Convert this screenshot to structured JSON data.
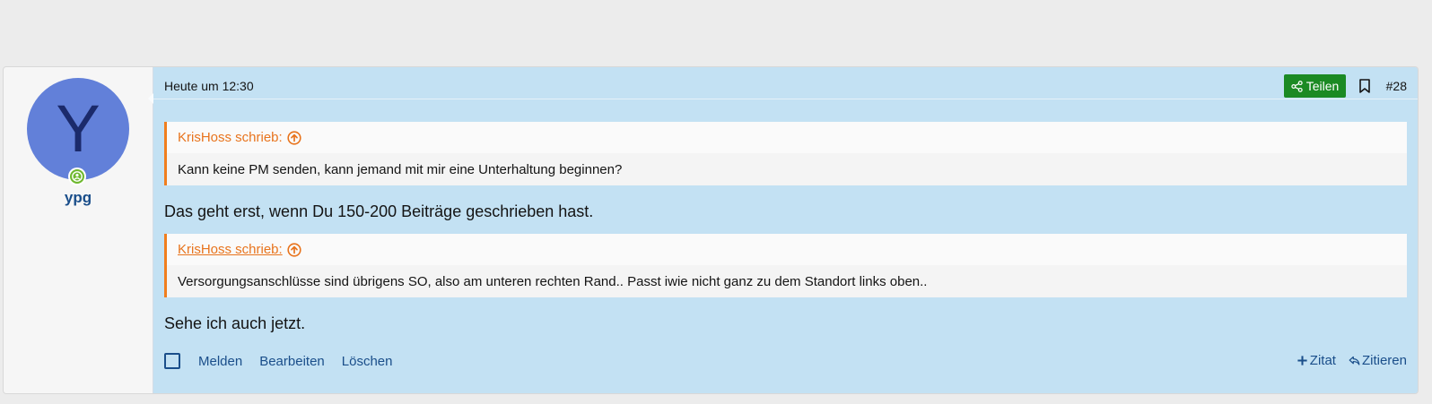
{
  "post": {
    "avatar_letter": "Y",
    "username": "ypg",
    "date": "Heute um 12:30",
    "share_label": "Teilen",
    "post_number": "#28",
    "quotes": [
      {
        "author": "KrisHoss schrieb:",
        "text": "Kann keine PM senden, kann jemand mit mir eine Unterhaltung beginnen?"
      },
      {
        "author": "KrisHoss schrieb:",
        "text": "Versorgungsanschlüsse sind übrigens SO, also am unteren rechten Rand.. Passt iwie nicht ganz zu dem Standort links oben.."
      }
    ],
    "paragraphs": [
      "Das geht erst, wenn Du 150-200 Beiträge geschrieben hast.",
      "Sehe ich auch jetzt."
    ],
    "footer": {
      "report": "Melden",
      "edit": "Bearbeiten",
      "delete": "Löschen",
      "add_quote": "Zitat",
      "reply_quote": "Zitieren"
    }
  },
  "colors": {
    "avatar_bg": "#6280d9",
    "message_bg": "#c3e1f3",
    "share_bg": "#1b8a23",
    "quote_accent": "#f07e1e",
    "link": "#1a4e8a"
  },
  "icons": [
    "online-status-icon",
    "share-icon",
    "bookmark-icon",
    "quote-arrow-up-icon",
    "plus-icon",
    "reply-icon"
  ]
}
